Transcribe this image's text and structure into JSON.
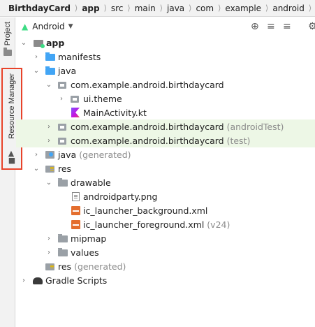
{
  "breadcrumb": [
    "BirthdayCard",
    "app",
    "src",
    "main",
    "java",
    "com",
    "example",
    "android",
    "birth"
  ],
  "toolstrip": {
    "project_tab": "Project",
    "resource_tab": "Resource Manager",
    "highlight_color": "#e8432a"
  },
  "panel": {
    "view_selector": "Android",
    "icons": [
      "crosshair-icon",
      "collapse-all-icon",
      "expand-all-icon",
      "gear-icon"
    ]
  },
  "tree": [
    {
      "label": "app",
      "suffix": "",
      "arrow": "expanded",
      "icon": "app-module-icon",
      "bold": true
    },
    {
      "label": "manifests",
      "suffix": "",
      "arrow": "collapsed",
      "icon": "folder-icon"
    },
    {
      "label": "java",
      "suffix": "",
      "arrow": "expanded",
      "icon": "folder-icon"
    },
    {
      "label": "com.example.android.birthdaycard",
      "suffix": "",
      "arrow": "expanded",
      "icon": "package-icon"
    },
    {
      "label": "ui.theme",
      "suffix": "",
      "arrow": "collapsed",
      "icon": "package-icon"
    },
    {
      "label": "MainActivity.kt",
      "suffix": "",
      "arrow": "none",
      "icon": "kotlin-file-icon"
    },
    {
      "label": "com.example.android.birthdaycard",
      "suffix": "(androidTest)",
      "arrow": "collapsed",
      "icon": "package-icon",
      "highlight": true
    },
    {
      "label": "com.example.android.birthdaycard",
      "suffix": "(test)",
      "arrow": "collapsed",
      "icon": "package-icon",
      "highlight": true
    },
    {
      "label": "java",
      "suffix": "(generated)",
      "arrow": "collapsed",
      "icon": "generated-folder-icon"
    },
    {
      "label": "res",
      "suffix": "",
      "arrow": "expanded",
      "icon": "res-folder-icon"
    },
    {
      "label": "drawable",
      "suffix": "",
      "arrow": "expanded",
      "icon": "folder-icon"
    },
    {
      "label": "androidparty.png",
      "suffix": "",
      "arrow": "none",
      "icon": "image-file-icon"
    },
    {
      "label": "ic_launcher_background.xml",
      "suffix": "",
      "arrow": "none",
      "icon": "xml-file-icon"
    },
    {
      "label": "ic_launcher_foreground.xml",
      "suffix": "(v24)",
      "arrow": "none",
      "icon": "xml-file-icon"
    },
    {
      "label": "mipmap",
      "suffix": "",
      "arrow": "collapsed",
      "icon": "folder-icon"
    },
    {
      "label": "values",
      "suffix": "",
      "arrow": "collapsed",
      "icon": "folder-icon"
    },
    {
      "label": "res",
      "suffix": "(generated)",
      "arrow": "none",
      "icon": "res-folder-icon"
    },
    {
      "label": "Gradle Scripts",
      "suffix": "",
      "arrow": "collapsed",
      "icon": "gradle-icon"
    }
  ],
  "colors": {
    "highlight_row": "#edf7e6",
    "android_green": "#3ddc84",
    "folder_blue": "#42a5f5",
    "suffix_gray": "#8c8c8c"
  }
}
